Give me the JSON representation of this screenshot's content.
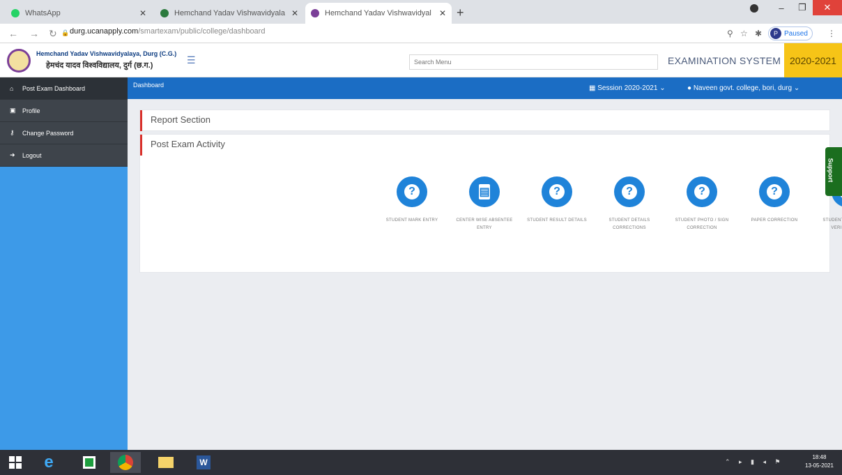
{
  "browser": {
    "tabs": [
      {
        "title": "WhatsApp",
        "active": false,
        "color": "#25d366"
      },
      {
        "title": "Hemchand Yadav Vishwavidyala",
        "active": false,
        "color": "#2b7a3d"
      },
      {
        "title": "Hemchand Yadav Vishwavidyal",
        "active": true,
        "color": "#7b3f98"
      }
    ],
    "new_tab": "+",
    "url_host": "durg.ucanapply.com",
    "url_path": "/smartexam/public/college/dashboard",
    "paused_label": "Paused",
    "profile_initial": "P"
  },
  "header": {
    "university_en": "Hemchand Yadav Vishwavidyalaya, Durg (C.G.)",
    "university_hi": "हेमचंद यादव विश्वविद्यालय, दुर्ग (छ.ग.)",
    "search_placeholder": "Search Menu",
    "system_title": "EXAMINATION SYSTEM",
    "year": "2020-2021"
  },
  "sidebar": {
    "items": [
      {
        "label": "Post Exam Dashboard",
        "icon": "home-icon"
      },
      {
        "label": "Profile",
        "icon": "profile-icon"
      },
      {
        "label": "Change Password",
        "icon": "key-icon"
      },
      {
        "label": "Logout",
        "icon": "logout-icon"
      }
    ]
  },
  "topbar": {
    "breadcrumb": "Dashboard",
    "session": "Session 2020-2021",
    "user": "Naveen govt. college, bori, durg"
  },
  "main": {
    "report_title": "Report Section",
    "activity_title": "Post Exam Activity",
    "activities": [
      {
        "label": "STUDENT MARK ENTRY"
      },
      {
        "label": "CENTER WISE ABSENTEE ENTRY"
      },
      {
        "label": "STUDENT RESULT DETAILS"
      },
      {
        "label": "STUDENT DETAILS CORRECTIONS"
      },
      {
        "label": "STUDENT PHOTO / SIGN CORRECTION"
      },
      {
        "label": "PAPER CORRECTION"
      },
      {
        "label": "STUDENT EXAMFORM VERIFICATION"
      }
    ]
  },
  "support_label": "Support",
  "taskbar": {
    "time": "18:48",
    "date": "13-05-2021"
  }
}
